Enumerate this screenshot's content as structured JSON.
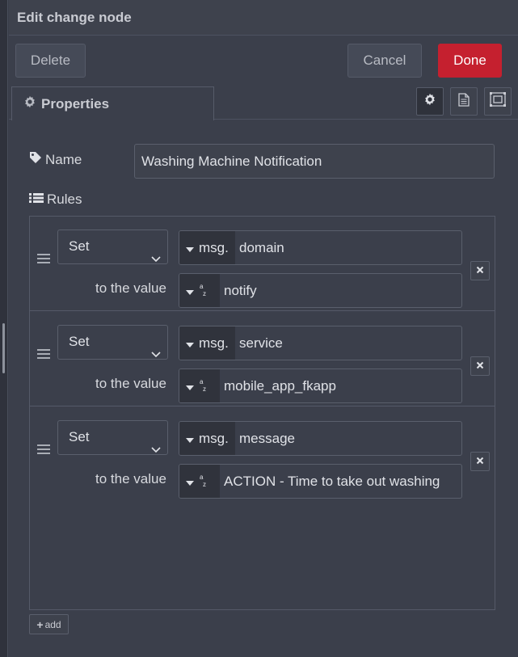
{
  "window": {
    "title": "Edit change node"
  },
  "toolbar": {
    "delete_label": "Delete",
    "cancel_label": "Cancel",
    "done_label": "Done",
    "done_color": "#c5202f"
  },
  "tabs": {
    "properties_label": "Properties",
    "icons": [
      "gear-icon",
      "description-icon",
      "appearance-icon"
    ]
  },
  "form": {
    "name_label": "Name",
    "name_value": "Washing Machine Notification",
    "rules_label": "Rules",
    "to_value_label": "to the value",
    "add_label": "add"
  },
  "rules": [
    {
      "action": "Set",
      "target_type": "msg.",
      "target": "domain",
      "value_type": "az",
      "value": "notify"
    },
    {
      "action": "Set",
      "target_type": "msg.",
      "target": "service",
      "value_type": "az",
      "value": "mobile_app_fkapp"
    },
    {
      "action": "Set",
      "target_type": "msg.",
      "target": "message",
      "value_type": "az",
      "value": "ACTION - Time to take out washing"
    }
  ]
}
